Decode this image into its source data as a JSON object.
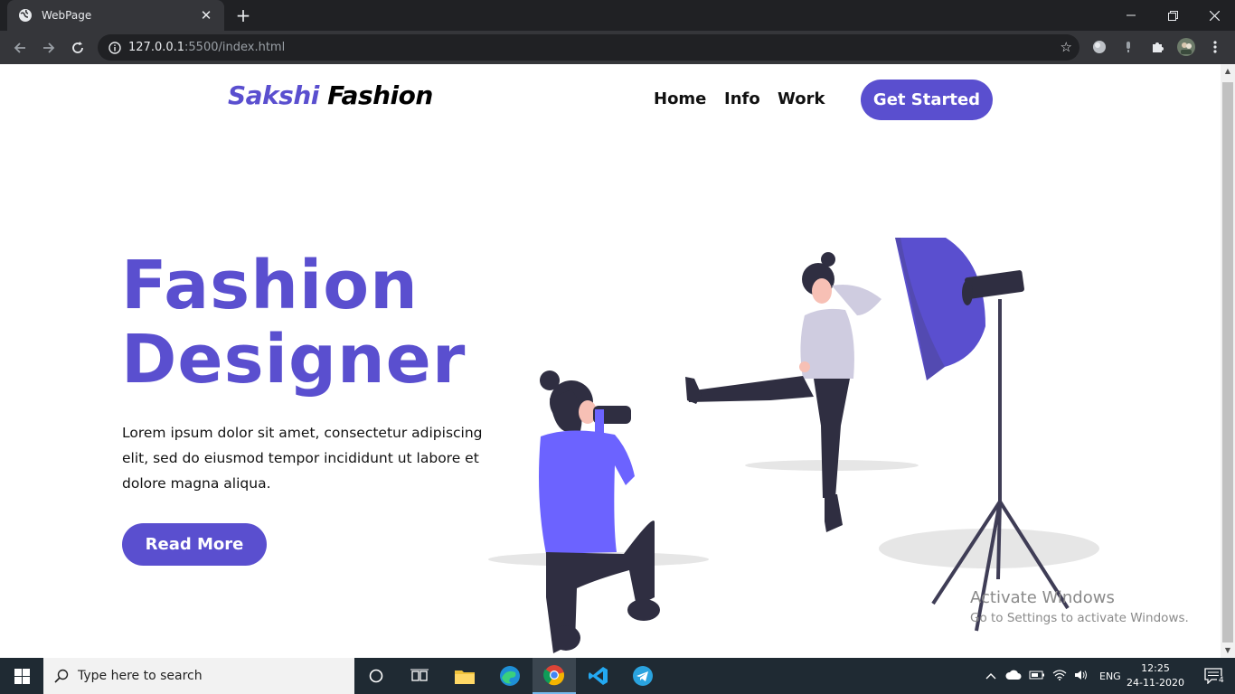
{
  "browser": {
    "tab_title": "WebPage",
    "new_tab": "+",
    "url_host": "127.0.0.1",
    "url_rest": ":5500/index.html",
    "icons": [
      "globe-icon",
      "close-icon",
      "back-icon",
      "forward-icon",
      "reload-icon",
      "info-icon",
      "star-icon",
      "puzzle-icon",
      "kebab-menu-icon"
    ]
  },
  "site": {
    "logo_part1": "Sakshi",
    "logo_part2": "Fashion",
    "nav": [
      "Home",
      "Info",
      "Work"
    ],
    "cta": "Get Started",
    "hero_line1": "Fashion",
    "hero_line2": "Designer",
    "hero_text": "Lorem ipsum dolor sit amet, consectetur adipiscing elit, sed do eiusmod tempor incididunt ut labore et dolore magna aliqua.",
    "read_more": "Read More",
    "accent": "#5a4fcf"
  },
  "windows": {
    "activate_title": "Activate Windows",
    "activate_sub": "Go to Settings to activate Windows.",
    "search_placeholder": "Type here to search",
    "lang": "ENG",
    "time": "12:25",
    "date": "24-11-2020",
    "notifications": "4"
  }
}
